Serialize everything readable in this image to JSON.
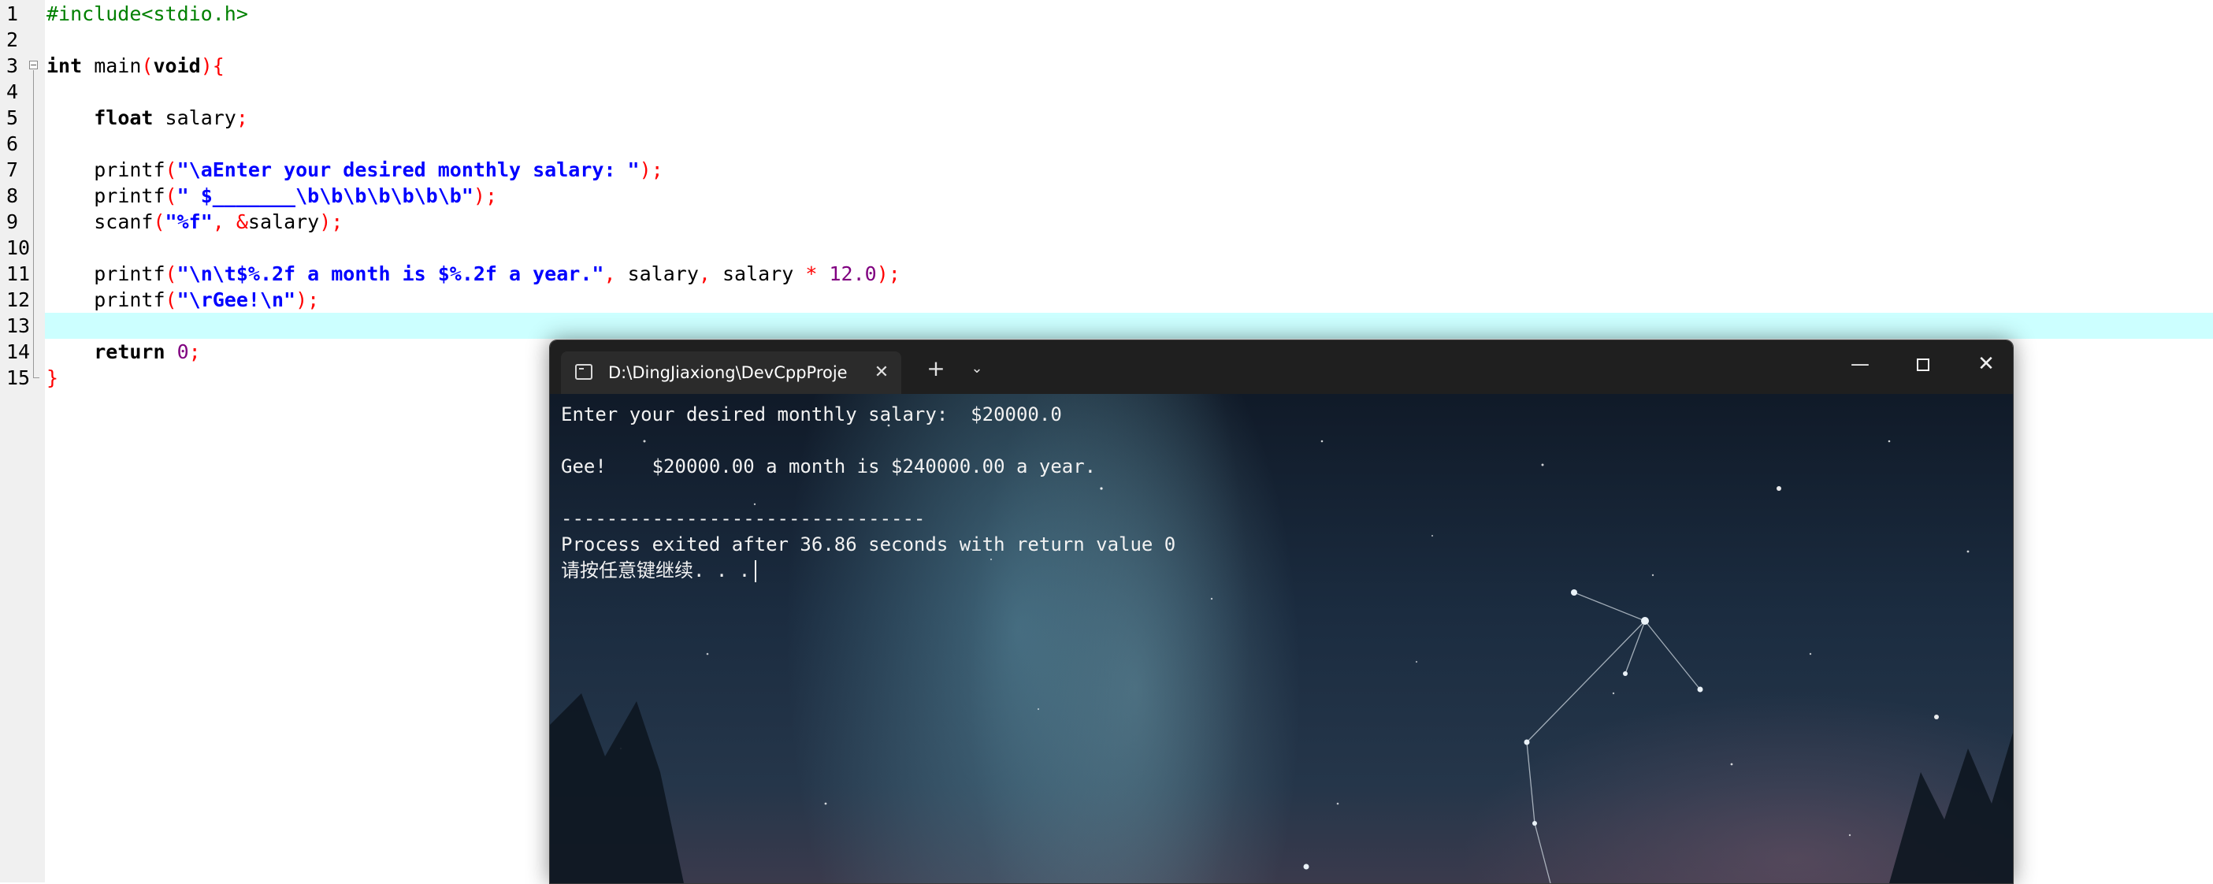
{
  "editor": {
    "line_numbers": [
      "1",
      "2",
      "3",
      "4",
      "5",
      "6",
      "7",
      "8",
      "9",
      "10",
      "11",
      "12",
      "13",
      "14",
      "15"
    ],
    "lines": {
      "l1": {
        "directive": "#include<stdio.h>"
      },
      "l3": {
        "kw": "int",
        "name": " main",
        "open_paren": "(",
        "kw2": "void",
        "close": "){"
      },
      "l5": {
        "indent": "    ",
        "kw": "float",
        "rest": " salary",
        "semi": ";"
      },
      "l7": {
        "indent": "    ",
        "fn": "printf",
        "open": "(",
        "str": "\"\\aEnter your desired monthly salary: \"",
        "close": ");"
      },
      "l8": {
        "indent": "    ",
        "fn": "printf",
        "open": "(",
        "str": "\" $_______\\b\\b\\b\\b\\b\\b\\b\"",
        "close": ");"
      },
      "l9": {
        "indent": "    ",
        "fn": "scanf",
        "open": "(",
        "str": "\"%f\"",
        "comma": ", &",
        "arg": "salary",
        "close": ");"
      },
      "l11": {
        "indent": "    ",
        "fn": "printf",
        "open": "(",
        "str": "\"\\n\\t$%.2f a month is $%.2f a year.\"",
        "comma1": ",",
        "arg1": " salary",
        "comma2": ",",
        "arg2": " salary ",
        "op": "*",
        "num": " 12.0",
        "close": ");"
      },
      "l12": {
        "indent": "    ",
        "fn": "printf",
        "open": "(",
        "str": "\"\\rGee!\\n\"",
        "close": ");"
      },
      "l14": {
        "indent": "    ",
        "kw": "return",
        "num": " 0",
        "semi": ";"
      },
      "l15": {
        "close": "}"
      }
    }
  },
  "terminal": {
    "tab_title": "D:\\DingJiaxiong\\DevCppProje",
    "tab_close": "✕",
    "new_tab": "+",
    "tab_menu": "⌄",
    "min": "—",
    "close": "✕",
    "output": [
      "Enter your desired monthly salary:  $20000.0",
      "",
      "Gee!    $20000.00 a month is $240000.00 a year.",
      "",
      "--------------------------------",
      "Process exited after 36.86 seconds with return value 0",
      "请按任意键继续. . ."
    ]
  },
  "colors": {
    "preprocessor": "#008000",
    "string": "#0000ff",
    "symbol": "#ff0000",
    "number": "#800080",
    "current_line": "#ccffff"
  }
}
